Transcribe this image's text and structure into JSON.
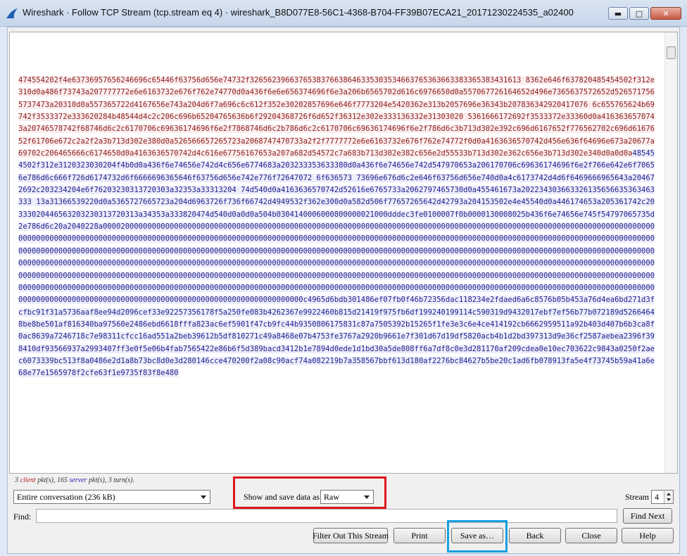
{
  "window": {
    "title": "Wireshark · Follow TCP Stream (tcp.stream eq 4) · wireshark_B8D077E8-56C1-4368-B704-FF39B07ECA21_20171230224535_a02400",
    "minimize_icon": "minimize-icon",
    "maximize_icon": "maximize-icon",
    "close_icon": "close-icon"
  },
  "stream": {
    "client_text": "474554202f4e63736957656246696c65446f63756d656e74732f3265623966376538376638646335303534663765363663383365383431613 8362e646f637820485454502f312e310d0a486f73743a207777772e6e6163732e676f762e74770d0a436f6e6e656374696f6e3a206b6565702d616c6976650d0a557067726164652d496e7365637572652d5265717565737473a20310d0a557365722d4167656e743a204d6f7a696c6c612f352e30202857696e646f7773204e5420362e313b2057696e36343b207836342920417076 6c655765624b69742f3533372e333620284b48544d4c2c206c696b65204765636b6f29204368726f6d652f36312e302e333136332e31303020 5361666172692f3533372e33360d0a4163636570743a20746578742f68746d6c2c6170706c69636174696f6e2f7868746d6c2b786d6c2c6170706c69636174696f6e2f786d6c3b713d302e392c696d6167652f776562702c696d6167652f61706e672c2a2f2a3b713d302e380d0a526566657265723a2068747470733a2f2f7777772e6e6163732e676f762e74772f0d0a4163636570742d456e636f64696e673a20677a69702c206465666c6174650d0a4163636570742d4c616e67756167653a207a682d54572c7a683b713d302e382c656e2d55533b713d302e362c656e3b713d302e340d0a0d0a",
    "server_text": "485454502f312e3120323030204f4b0d0a436f6e74656e742d4c656e6774683a203233353633380d0a436f6e74656e742d547970653a206170706c69636174696f6e2f766e642e6f70656e786d6c666f726d6174732d6f6666696365646f63756d656e742e776f72647072 6f636573 73696e676d6c2e646f63756d656e740d0a4c6173742d4d6f6469666965643a204672692c203234204e6f76203230313720303a32353a33313204 74d540d0a4163636570742d52616e6765733a2062797465730d0a455461673a202234303663326135656635363463333 13a31366539220d0a5365727665723a204d6963726f736f66742d4949532f362e300d0a582d506f77657265642d42793a204153502e4e45540d0a446174653a205361742c20333020446563203230313720313a34353a333820474d540d0a0d0a504b0304140006000800000021000dddec3fe0100007f0b0000130008025b436f6e74656e745f54797065735d2e786d6c20a2040228a000020000000000000000000000000000000000000000000000000000000000000000000000000000000000000000000000000000000000000000000000000000000000000000000000000000000000000000000000000000000000000000000000000000000000000000000000000000000000000000000000000000000000000000000000000000000000000000000000000000000000000000000000000000000000000000000000000000000000000000000000000000000000000000000000000000000000000000000000000000000000000000000000000000000000000000000000000000000000000000000000000000000000000000000000000000000000000000000000000000000000000000000000000000000000000000000000000000000000000000000000000000000000000000000000000000000000000000000000000000000000000000000000000000000000000000000000000000000000000000000000000000000000000000000000000000000000000000000000000000000000000000000000000000000000000000000000000000000000000000000000000000000000000000000000000000000000000000000000000000000000c4965d6bdb301486ef07fb0f46b72356dac118234e2fdaed6a6c8576b05b453a76d4ea6bd271d3fcfbc91f31a5736aaf8ee94d2096cef33e92257356178f5a250fe083b4262367e9922460b815d21419f975fb6df199240199114c590319d9432017ebf7ef56b77b072189d52664648be8be501af816340ba97560e2486ebd6618fffa823ac6ef5901f47cb9fc44b9350806175831c87a7505392b15265f1fe3e3c6e4ce414192cb6662959511a92b403d407b6b3ca8f0ac8639a7246718c7e98311cfcc16ad551a2beb39612b5df810271c49a8468e07b4753fe3767a2920b9661e7f301d67d19df5820acb4b1d2bd397313d9e36cf2587aebea2396f398410df93566937a2993407ff3e0f5e06b4fab7565422e86b6f5d389bacd3412b1e7894d0ede1d1bd30a5de808ff6a7df8c0e3d281170af209cdea0e10ec703622c9843a0250f2aec6073339bc513f8a0486e2d1a8b73bc8d0e3d280146cce470200f2a08c90acf74a082219b7a358567bbf613d180af2276bc84627b5be20c1ad6fb078913fa5e4f73745b59a41a6e68e77e1565978f2cfe63f1e9735f83f8e480"
  },
  "status": {
    "prefix": "3",
    "client_word": "client",
    "middle": "pkt(s), 165",
    "server_word": "server",
    "suffix": "pkt(s), 3 turn(s)."
  },
  "conversation_select": {
    "value": "Entire conversation (236 kB)"
  },
  "show_as": {
    "label": "Show and save data as",
    "value": "Raw"
  },
  "stream_num": {
    "label": "Stream",
    "value": "4"
  },
  "find": {
    "label": "Find:",
    "value": ""
  },
  "buttons": {
    "find_next": "Find Next",
    "filter_out": "Filter Out This Stream",
    "print": "Print",
    "save_as": "Save as…",
    "back": "Back",
    "close": "Close",
    "help": "Help"
  },
  "colors": {
    "highlight_red": "#e0161d",
    "highlight_blue": "#19a0e0",
    "client_fg": "#8b1f1f",
    "server_fg": "#1e1e8c"
  }
}
